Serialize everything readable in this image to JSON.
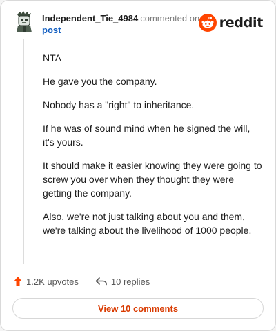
{
  "comment": {
    "username": "Independent_Tie_4984",
    "action_text": "commented on",
    "post_link": "post",
    "brand": "reddit",
    "paragraphs": [
      "NTA",
      "He gave you the company.",
      "Nobody has a \"right\" to inheritance.",
      "If he was of sound mind when he signed the will, it's yours.",
      "It should make it easier knowing they were going to screw you over when they thought they were getting the company.",
      "Also, we're not just talking about you and them, we're talking about the livelihood of 1000 people."
    ]
  },
  "actions": {
    "upvotes": "1.2K upvotes",
    "replies": "10 replies"
  },
  "footer": {
    "view_comments": "View 10 comments"
  },
  "icons": {
    "avatar": "avatar-icon",
    "logo": "reddit-logo-icon",
    "upvote": "upvote-arrow-icon",
    "reply": "reply-arrow-icon"
  },
  "colors": {
    "brand": "#ff4500",
    "upvote": "#ff4500",
    "link": "#0f5cc0",
    "button_text": "#d93a00"
  }
}
